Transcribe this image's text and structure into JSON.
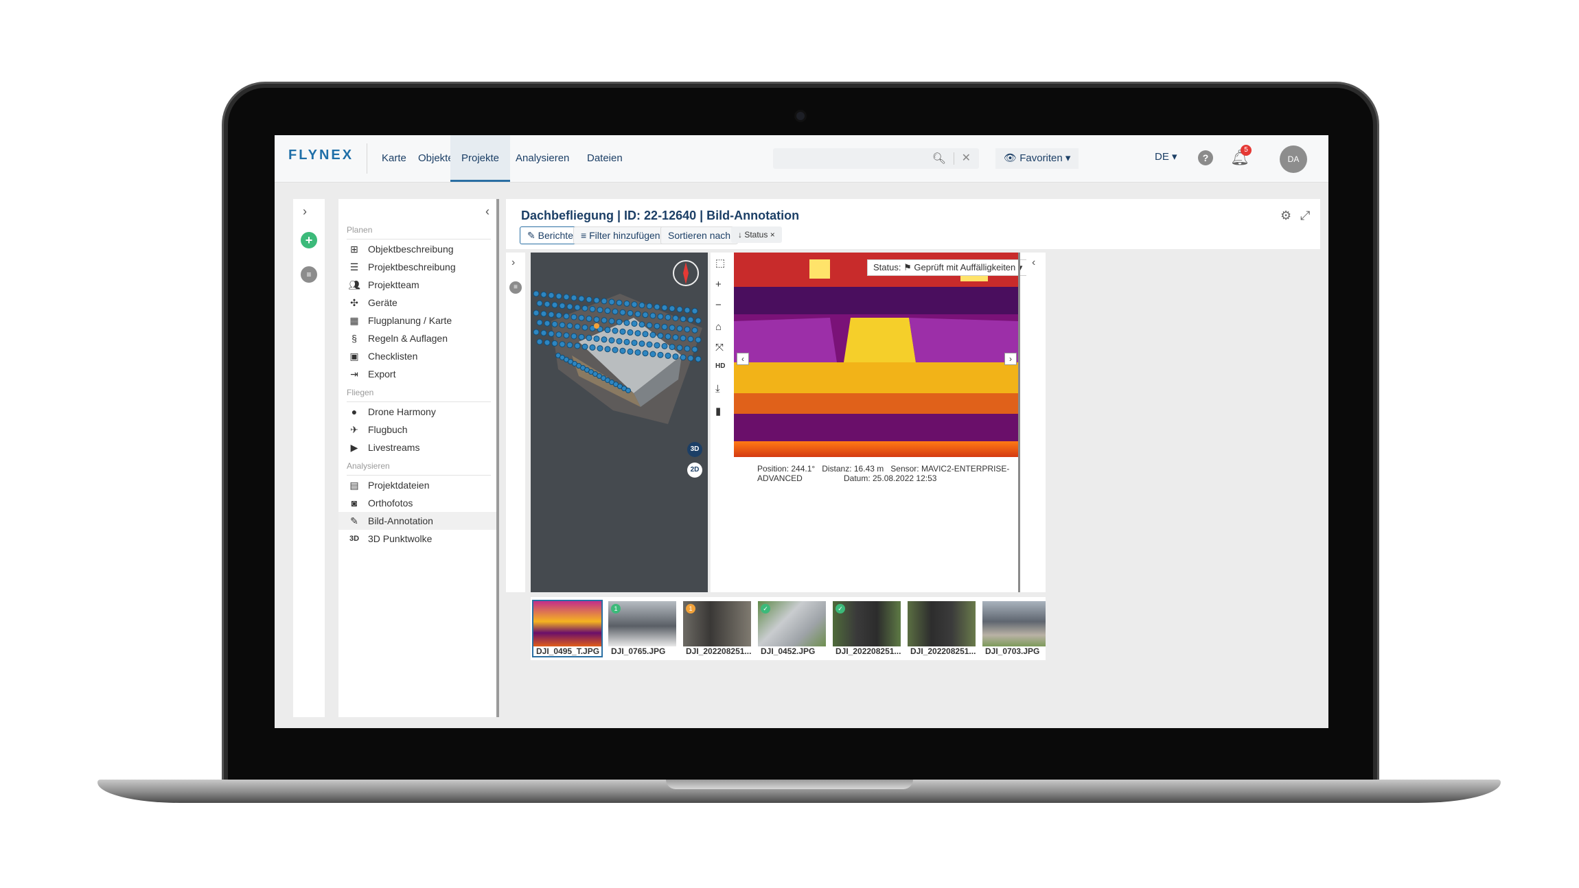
{
  "app": {
    "logo": "FLYNEX"
  },
  "nav": [
    "Karte",
    "Objekte",
    "Projekte",
    "Analysieren",
    "Dateien"
  ],
  "active_nav": "Projekte",
  "search": {
    "placeholder": ""
  },
  "favorites": "Favoriten",
  "language": "DE",
  "notifications": "5",
  "user_initials": "DA",
  "sidebar": {
    "sections": [
      {
        "title": "Planen",
        "items": [
          "Objektbeschreibung",
          "Projektbeschreibung",
          "Projektteam",
          "Geräte",
          "Flugplanung / Karte",
          "Regeln & Auflagen",
          "Checklisten",
          "Export"
        ]
      },
      {
        "title": "Fliegen",
        "items": [
          "Drone Harmony",
          "Flugbuch",
          "Livestreams"
        ]
      },
      {
        "title": "Analysieren",
        "items": [
          "Projektdateien",
          "Orthofotos",
          "Bild-Annotation",
          "3D Punktwolke"
        ]
      }
    ],
    "selected": "Bild-Annotation"
  },
  "page": {
    "title": "Dachbefliegung | ID: 22-12640 | Bild-Annotation",
    "buttons": {
      "reports": "Berichte",
      "add_filter": "Filter hinzufügen",
      "sort": "Sortieren nach"
    },
    "status_chip": "↓ Status"
  },
  "viewer3d": {
    "btn_3d": "3D",
    "btn_2d": "2D"
  },
  "image": {
    "status_label": "Status:",
    "status_value": "Geprüft mit Auffälligkeiten",
    "position": "Position: 244.1°",
    "distance": "Distanz: 16.43 m",
    "sensor": "Sensor: MAVIC2-ENTERPRISE-ADVANCED",
    "date": "Datum: 25.08.2022 12:53"
  },
  "thumbnails": [
    {
      "name": "DJI_0495_T.JPG",
      "badge": ""
    },
    {
      "name": "DJI_0765.JPG",
      "badge": "1"
    },
    {
      "name": "DJI_202208251...",
      "badge": "1"
    },
    {
      "name": "DJI_0452.JPG",
      "badge": "✓"
    },
    {
      "name": "DJI_202208251...",
      "badge": "✓"
    },
    {
      "name": "DJI_202208251...",
      "badge": ""
    },
    {
      "name": "DJI_0703.JPG",
      "badge": ""
    }
  ],
  "colors": {
    "brand": "#1f6fa8",
    "navy": "#1c3f66",
    "green": "#3cba7a",
    "orange": "#f2a23a"
  }
}
